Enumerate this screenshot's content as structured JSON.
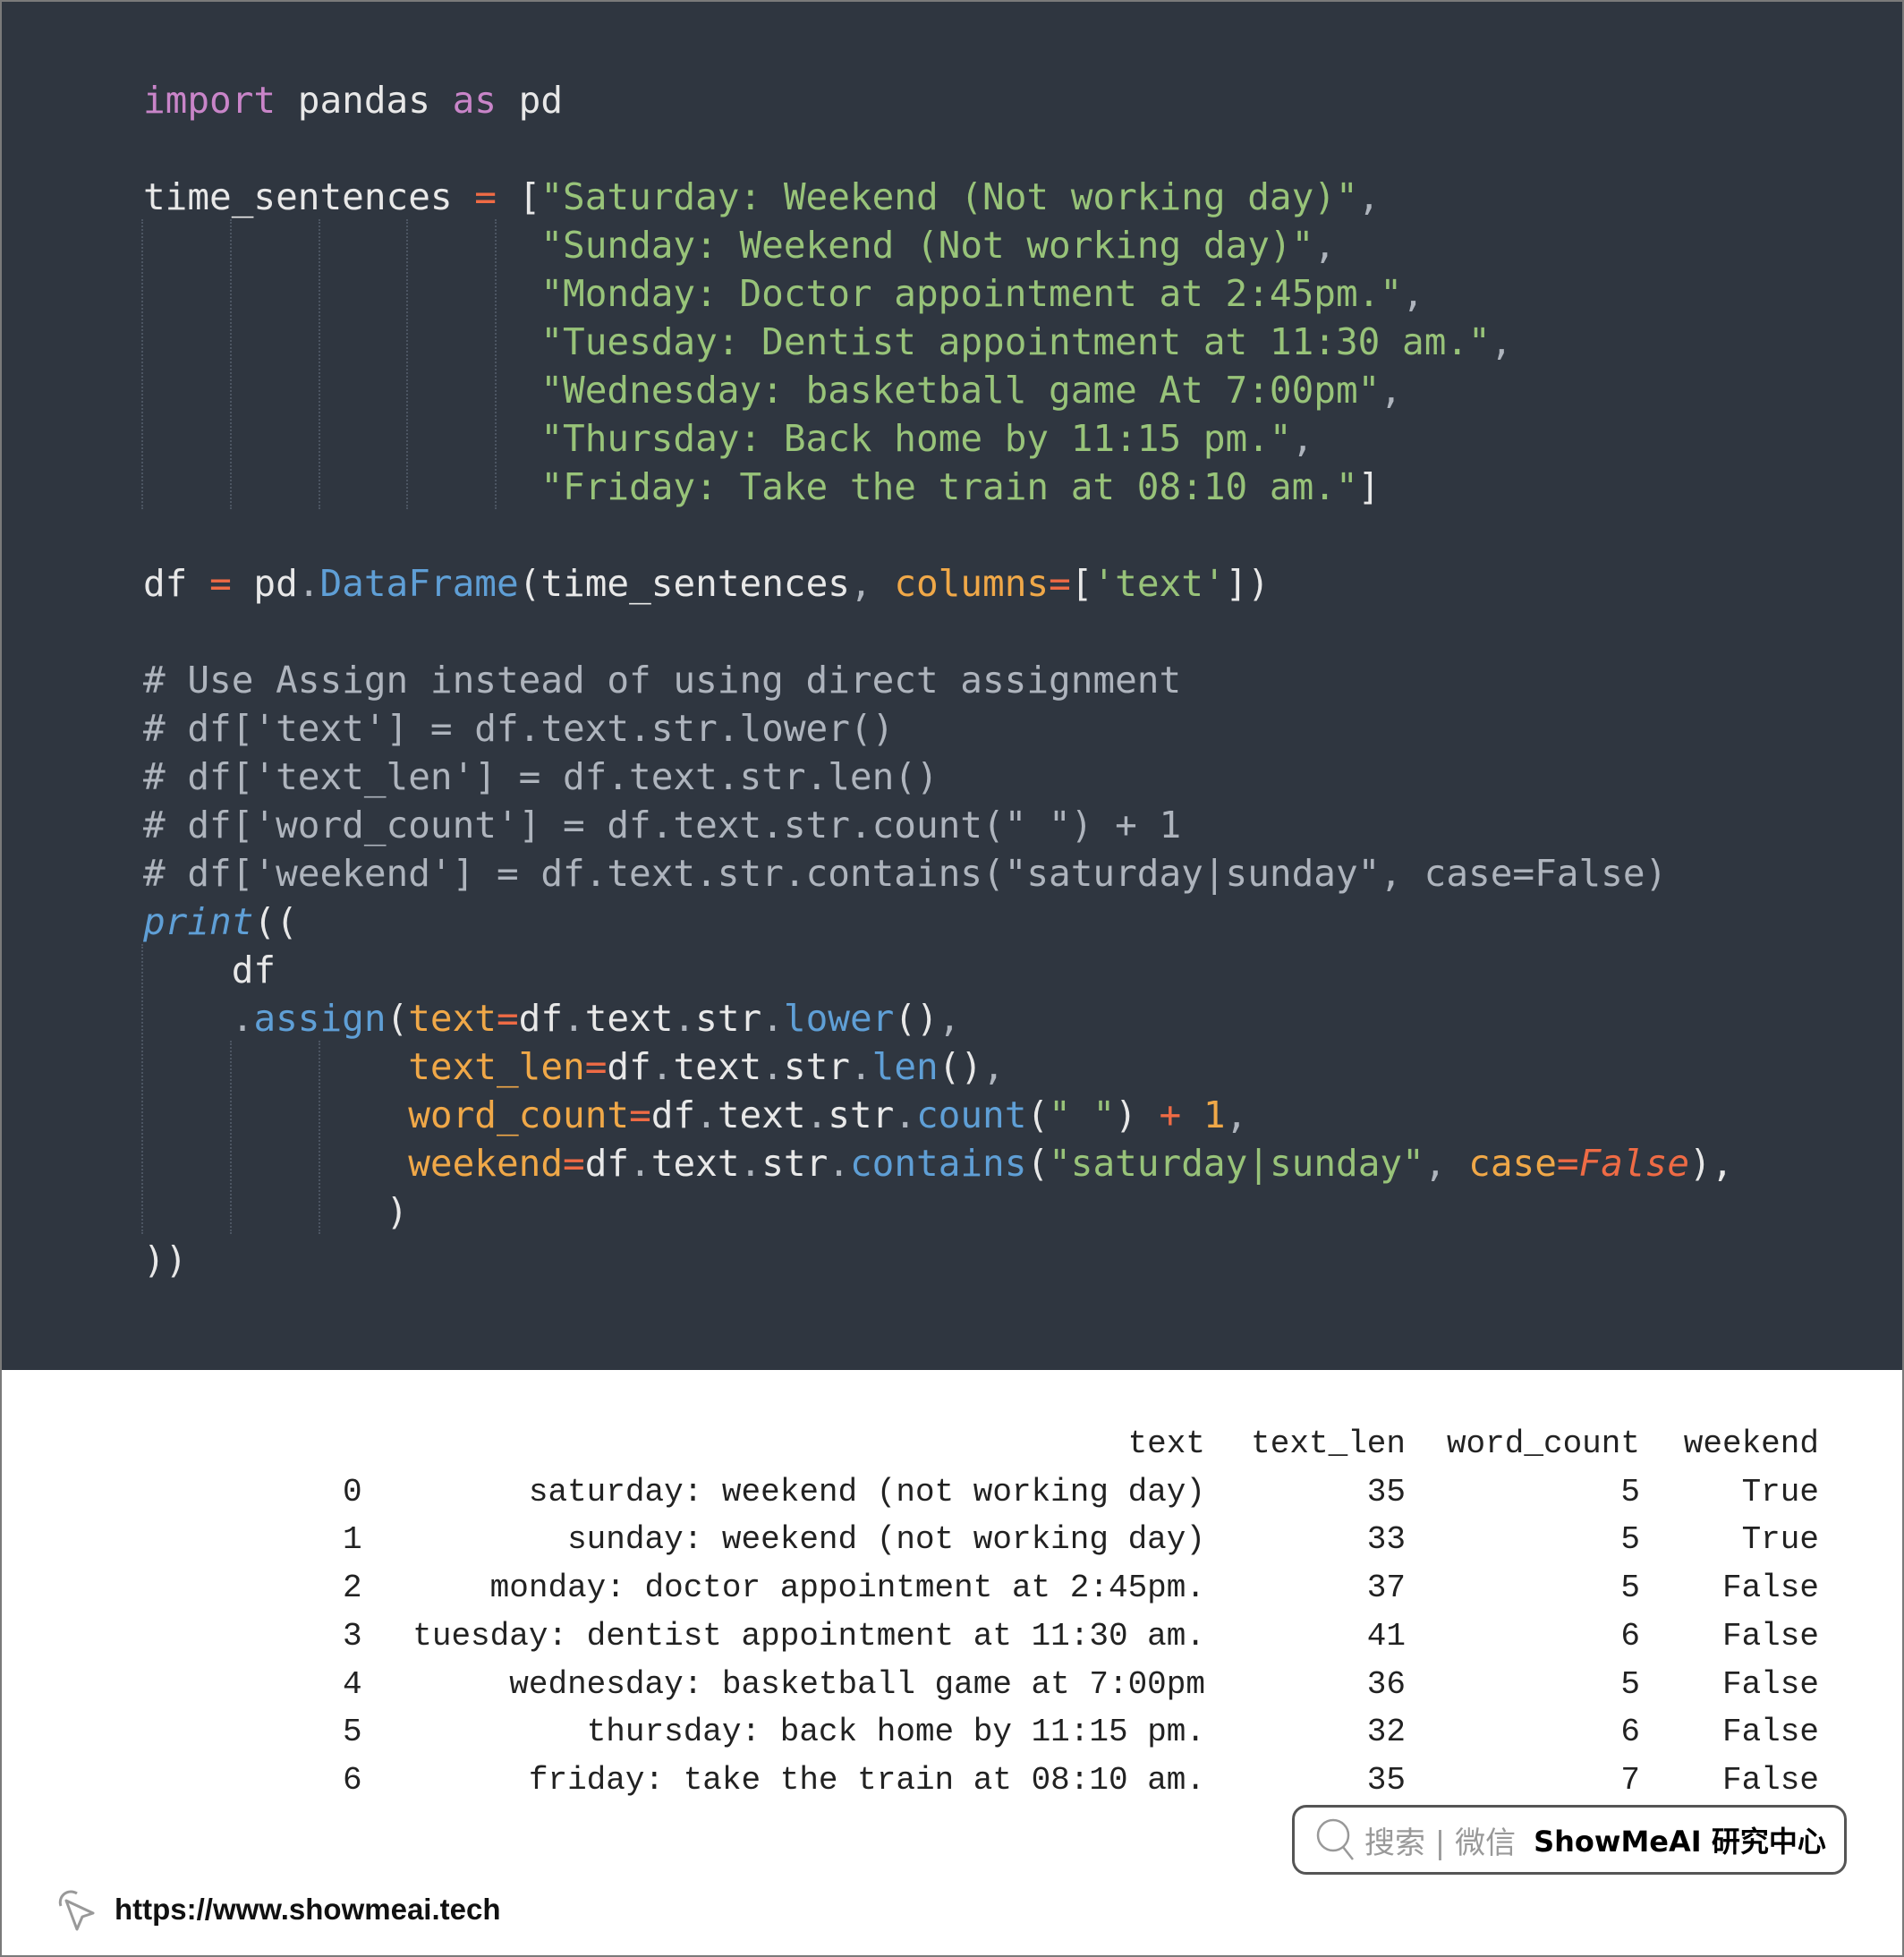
{
  "code_lines": [
    [
      [
        "import",
        "k"
      ],
      [
        " pandas ",
        "n"
      ],
      [
        "as",
        "k"
      ],
      [
        " pd",
        "n"
      ]
    ],
    [],
    [
      [
        "time_sentences ",
        "n"
      ],
      [
        "=",
        "o"
      ],
      [
        " [",
        "n"
      ],
      [
        "\"Saturday: Weekend (Not working day)\"",
        "s"
      ],
      [
        ",",
        "pu"
      ]
    ],
    [
      [
        "                  ",
        "n"
      ],
      [
        "\"Sunday: Weekend (Not working day)\"",
        "s"
      ],
      [
        ",",
        "pu"
      ]
    ],
    [
      [
        "                  ",
        "n"
      ],
      [
        "\"Monday: Doctor appointment at 2:45pm.\"",
        "s"
      ],
      [
        ",",
        "pu"
      ]
    ],
    [
      [
        "                  ",
        "n"
      ],
      [
        "\"Tuesday: Dentist appointment at 11:30 am.\"",
        "s"
      ],
      [
        ",",
        "pu"
      ]
    ],
    [
      [
        "                  ",
        "n"
      ],
      [
        "\"Wednesday: basketball game At 7:00pm\"",
        "s"
      ],
      [
        ",",
        "pu"
      ]
    ],
    [
      [
        "                  ",
        "n"
      ],
      [
        "\"Thursday: Back home by 11:15 pm.\"",
        "s"
      ],
      [
        ",",
        "pu"
      ]
    ],
    [
      [
        "                  ",
        "n"
      ],
      [
        "\"Friday: Take the train at 08:10 am.\"",
        "s"
      ],
      [
        "]",
        "n"
      ]
    ],
    [],
    [
      [
        "df ",
        "n"
      ],
      [
        "=",
        "o"
      ],
      [
        " pd",
        "n"
      ],
      [
        ".",
        "pu"
      ],
      [
        "DataFrame",
        "f"
      ],
      [
        "(time_sentences",
        "n"
      ],
      [
        ", ",
        "pu"
      ],
      [
        "columns",
        "p"
      ],
      [
        "=",
        "o"
      ],
      [
        "[",
        "n"
      ],
      [
        "'text'",
        "s"
      ],
      [
        "])",
        "n"
      ]
    ],
    [],
    [
      [
        "# Use Assign instead of using direct assignment",
        "c"
      ]
    ],
    [
      [
        "# df['text'] = df.text.str.lower()",
        "c"
      ]
    ],
    [
      [
        "# df['text_len'] = df.text.str.len()",
        "c"
      ]
    ],
    [
      [
        "# df['word_count'] = df.text.str.count(\" \") + 1",
        "c"
      ]
    ],
    [
      [
        "# df['weekend'] = df.text.str.contains(\"saturday|sunday\", case=False)",
        "c"
      ]
    ],
    [
      [
        "print",
        "pr"
      ],
      [
        "((",
        "n"
      ]
    ],
    [
      [
        "    df",
        "n"
      ]
    ],
    [
      [
        "    ",
        "n"
      ],
      [
        ".",
        "pu"
      ],
      [
        "assign",
        "f"
      ],
      [
        "(",
        "n"
      ],
      [
        "text",
        "p"
      ],
      [
        "=",
        "o"
      ],
      [
        "df",
        "n"
      ],
      [
        ".",
        "pu"
      ],
      [
        "text",
        "n"
      ],
      [
        ".",
        "pu"
      ],
      [
        "str",
        "n"
      ],
      [
        ".",
        "pu"
      ],
      [
        "lower",
        "f"
      ],
      [
        "()",
        "n"
      ],
      [
        ",",
        "pu"
      ]
    ],
    [
      [
        "            ",
        "n"
      ],
      [
        "text_len",
        "p"
      ],
      [
        "=",
        "o"
      ],
      [
        "df",
        "n"
      ],
      [
        ".",
        "pu"
      ],
      [
        "text",
        "n"
      ],
      [
        ".",
        "pu"
      ],
      [
        "str",
        "n"
      ],
      [
        ".",
        "pu"
      ],
      [
        "len",
        "f"
      ],
      [
        "()",
        "n"
      ],
      [
        ",",
        "pu"
      ]
    ],
    [
      [
        "            ",
        "n"
      ],
      [
        "word_count",
        "p"
      ],
      [
        "=",
        "o"
      ],
      [
        "df",
        "n"
      ],
      [
        ".",
        "pu"
      ],
      [
        "text",
        "n"
      ],
      [
        ".",
        "pu"
      ],
      [
        "str",
        "n"
      ],
      [
        ".",
        "pu"
      ],
      [
        "count",
        "f"
      ],
      [
        "(",
        "n"
      ],
      [
        "\" \"",
        "s"
      ],
      [
        ") ",
        "n"
      ],
      [
        "+",
        "o"
      ],
      [
        " ",
        "n"
      ],
      [
        "1",
        "p"
      ],
      [
        ",",
        "pu"
      ]
    ],
    [
      [
        "            ",
        "n"
      ],
      [
        "weekend",
        "p"
      ],
      [
        "=",
        "o"
      ],
      [
        "df",
        "n"
      ],
      [
        ".",
        "pu"
      ],
      [
        "text",
        "n"
      ],
      [
        ".",
        "pu"
      ],
      [
        "str",
        "n"
      ],
      [
        ".",
        "pu"
      ],
      [
        "contains",
        "f"
      ],
      [
        "(",
        "n"
      ],
      [
        "\"saturday|sunday\"",
        "s"
      ],
      [
        ", ",
        "pu"
      ],
      [
        "case",
        "p"
      ],
      [
        "=",
        "o"
      ],
      [
        "False",
        "b"
      ],
      [
        "),",
        "n"
      ]
    ],
    [
      [
        "           )",
        "n"
      ]
    ],
    [
      [
        "))",
        "n"
      ]
    ]
  ],
  "output": {
    "columns": [
      "text",
      "text_len",
      "word_count",
      "weekend"
    ],
    "rows": [
      {
        "index": "0",
        "text": "saturday: weekend (not working day)",
        "text_len": "35",
        "word_count": "5",
        "weekend": "True"
      },
      {
        "index": "1",
        "text": "sunday: weekend (not working day)",
        "text_len": "33",
        "word_count": "5",
        "weekend": "True"
      },
      {
        "index": "2",
        "text": "monday: doctor appointment at 2:45pm.",
        "text_len": "37",
        "word_count": "5",
        "weekend": "False"
      },
      {
        "index": "3",
        "text": "tuesday: dentist appointment at 11:30 am.",
        "text_len": "41",
        "word_count": "6",
        "weekend": "False"
      },
      {
        "index": "4",
        "text": "wednesday: basketball game at 7:00pm",
        "text_len": "36",
        "word_count": "5",
        "weekend": "False"
      },
      {
        "index": "5",
        "text": "thursday: back home by 11:15 pm.",
        "text_len": "32",
        "word_count": "6",
        "weekend": "False"
      },
      {
        "index": "6",
        "text": "friday: take the train at 08:10 am.",
        "text_len": "35",
        "word_count": "7",
        "weekend": "False"
      }
    ]
  },
  "badge": {
    "search_icon": "search-icon",
    "search_label": "搜索 | 微信",
    "brand": "ShowMeAI 研究中心"
  },
  "footer": {
    "icon": "cursor-click-icon",
    "url": "https://www.showmeai.tech"
  },
  "colors": {
    "code_background": "#2f3640",
    "keyword": "#c985c9",
    "string": "#98c379",
    "operator": "#ef6b45",
    "function": "#5f9fd6",
    "parameter": "#f0a848",
    "comment": "#aeb4bd"
  }
}
